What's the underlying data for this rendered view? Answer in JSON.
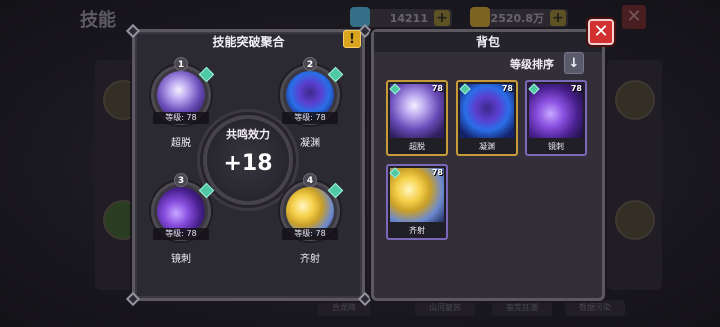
{
  "background": {
    "title": "技能",
    "currency_1": "14211",
    "currency_2": "2520.8万",
    "bottom_tabs": [
      "合龙阵",
      "山河复苏",
      "蛮荒狂潮",
      "数据污染"
    ]
  },
  "left_panel": {
    "title": "技能突破聚合",
    "bonus_label": "共鸣效力",
    "bonus_value": "+18",
    "slots": [
      {
        "num": "1",
        "level": "等级: 78",
        "name": "超脱"
      },
      {
        "num": "2",
        "level": "等级: 78",
        "name": "凝渊"
      },
      {
        "num": "3",
        "level": "等级: 78",
        "name": "镜刺"
      },
      {
        "num": "4",
        "level": "等级: 78",
        "name": "齐射"
      }
    ]
  },
  "right_panel": {
    "title": "背包",
    "sort_label": "等级排序",
    "items": [
      {
        "level": "78",
        "name": "超脱"
      },
      {
        "level": "78",
        "name": "凝渊"
      },
      {
        "level": "78",
        "name": "镜刺"
      },
      {
        "level": "78",
        "name": "齐射"
      }
    ]
  },
  "icons": {
    "warning": "!",
    "sort": "↓",
    "close": "✕",
    "plus": "+"
  },
  "colors": {
    "close_red": "#d23030",
    "warn_gold": "#d9a520",
    "gem_green": "#4ec9a4",
    "selected_gold": "#c79a3a"
  }
}
